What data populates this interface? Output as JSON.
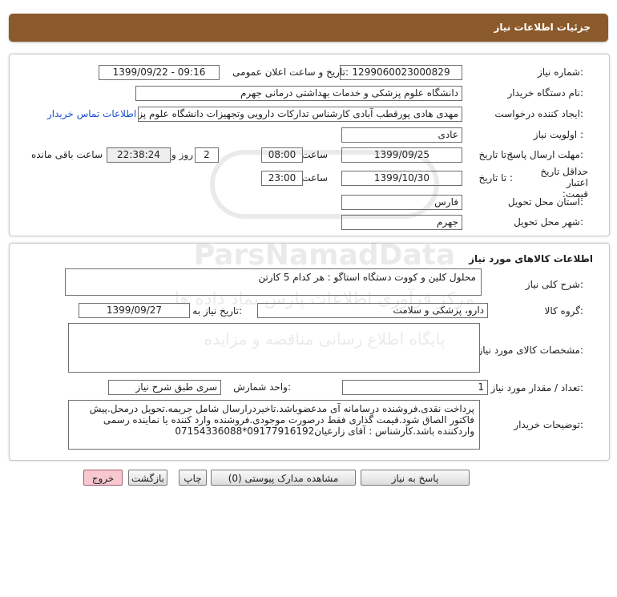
{
  "header": {
    "title": "جزئیات اطلاعات نیاز"
  },
  "general": {
    "need_number_label": "شماره نیاز:",
    "need_number": "1299060023000829",
    "announce_label": "تاریخ و ساعت اعلان عمومی:",
    "announce_value": "1399/09/22 - 09:16",
    "buyer_label": "نام دستگاه خریدار:",
    "buyer_value": "دانشگاه علوم پزشکی و خدمات بهداشتی درمانی جهرم",
    "creator_label": "ایجاد کننده درخواست:",
    "creator_value": "مهدی هادی پورقطب آبادی کارشناس تدارکات دارویی وتجهیزات دانشگاه علوم پزشکی",
    "contact_link": "اطلاعات تماس خریدار",
    "priority_label": "اولویت نیاز :",
    "priority_value": "عادی",
    "deadline_label": "مهلت ارسال پاسخ:",
    "to_date_label": "تا تاریخ :",
    "deadline_date": "1399/09/25",
    "time_label": "ساعت",
    "deadline_time": "08:00",
    "days_value": "2",
    "days_label": "روز و",
    "remaining_time": "22:38:24",
    "remaining_label": "ساعت باقی مانده",
    "validity_label": "حداقل تاریخ اعتبار قیمت:",
    "validity_to_label": "تا تاریخ :",
    "validity_date": "1399/10/30",
    "validity_time_label": "ساعت",
    "validity_time": "23:00",
    "province_label": "استان محل تحویل:",
    "province_value": "فارس",
    "city_label": "شهر محل تحویل:",
    "city_value": "جهرم"
  },
  "goods": {
    "section_title": "اطلاعات کالاهای مورد نیاز",
    "desc_label": "شرح کلی نیاز:",
    "desc_value": "محلول کلین  و کووت دستگاه استاگو : هر کدام 5 کارتن",
    "group_label": "گروه کالا:",
    "group_value": "دارو، پزشکی و سلامت",
    "need_date_label": "تاریخ نیاز به کالا:",
    "need_date_value": "1399/09/27",
    "specs_label": "مشخصات کالای مورد نیاز:",
    "specs_value": "",
    "qty_label": "تعداد / مقدار مورد نیاز:",
    "qty_value": "1",
    "unit_label": "واحد شمارش:",
    "unit_value": "سری طبق شرح نیاز",
    "notes_label": "توضیحات خریدار:",
    "notes_value": "پرداخت نقدی.فروشنده درسامانه آی مدعضوباشد.تاخیردرارسال شامل جریمه.تحویل درمحل.پیش فاکتور الصاق شود.قیمت گذاری فقط درصورت موجودی.فروشنده وارد کننده یا نماینده رسمی واردکننده باشد.کارشناس : آقای زارعیان09177916192*07154336088"
  },
  "buttons": {
    "reply": "پاسخ به نیاز",
    "attachments": "مشاهده مدارک پیوستی (0)",
    "print": "چاپ",
    "back": "بازگشت",
    "exit": "خروج"
  },
  "watermark": {
    "brand": "ParsNamadData",
    "line1": "مرکز فرآوری اطلاعات پارس نماد داده ها",
    "line2": "پایگاه اطلاع رسانی مناقصه و مزایده"
  },
  "colors": {
    "header_bg": "#8b5a2b",
    "link": "#1a4fd1",
    "exit_button": "#f8c7cf",
    "remaining_bg": "#eeeeee"
  }
}
